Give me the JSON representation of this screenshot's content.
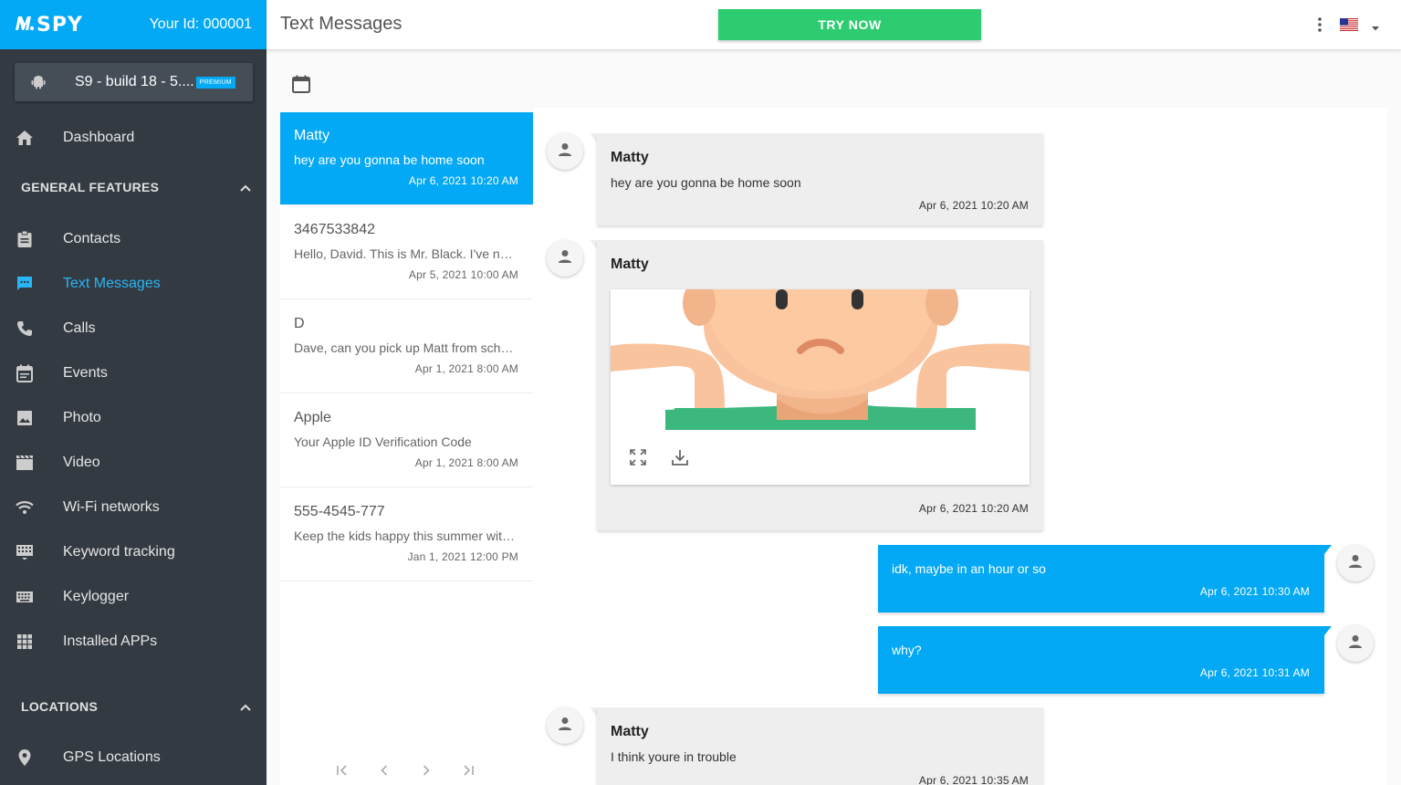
{
  "app": {
    "logo_text": "SPY",
    "user_id": "Your Id: 000001",
    "device_name": "S9 - build 18 - 5....",
    "device_badge": "PREMIUM"
  },
  "sidebar": {
    "dashboard": "Dashboard",
    "general_header": "GENERAL FEATURES",
    "items": [
      {
        "label": "Contacts",
        "icon": "clipboard-icon"
      },
      {
        "label": "Text Messages",
        "icon": "message-icon",
        "active": true
      },
      {
        "label": "Calls",
        "icon": "phone-icon"
      },
      {
        "label": "Events",
        "icon": "calendar-icon"
      },
      {
        "label": "Photo",
        "icon": "image-icon"
      },
      {
        "label": "Video",
        "icon": "movie-icon"
      },
      {
        "label": "Wi-Fi networks",
        "icon": "wifi-icon"
      },
      {
        "label": "Keyword tracking",
        "icon": "keyboard-monitor-icon"
      },
      {
        "label": "Keylogger",
        "icon": "keyboard-icon"
      },
      {
        "label": "Installed APPs",
        "icon": "apps-grid-icon"
      }
    ],
    "locations_header": "LOCATIONS",
    "gps": "GPS Locations"
  },
  "header": {
    "title": "Text Messages",
    "try_now": "TRY NOW"
  },
  "conversations": [
    {
      "name": "Matty",
      "preview": "hey are you gonna be home soon",
      "time": "Apr 6, 2021 10:20 AM",
      "active": true
    },
    {
      "name": "3467533842",
      "preview": "Hello, David. This is Mr. Black. I've noticed",
      "time": "Apr 5, 2021 10:00 AM"
    },
    {
      "name": "D",
      "preview": "Dave, can you pick up Matt from school today",
      "time": "Apr 1, 2021 8:00 AM"
    },
    {
      "name": "Apple",
      "preview": "Your Apple ID Verification Code",
      "time": "Apr 1, 2021 8:00 AM"
    },
    {
      "name": "555-4545-777",
      "preview": "Keep the kids happy this summer with our deals",
      "time": "Jan 1, 2021 12:00 PM"
    }
  ],
  "messages": [
    {
      "direction": "in",
      "sender": "Matty",
      "text": "hey are you gonna be home soon",
      "time": "Apr 6, 2021 10:20 AM"
    },
    {
      "direction": "in",
      "sender": "Matty",
      "media": "image",
      "time": "Apr 6, 2021 10:20 AM"
    },
    {
      "direction": "out",
      "text": "idk, maybe in an hour or so",
      "time": "Apr 6, 2021 10:30 AM"
    },
    {
      "direction": "out",
      "text": "why?",
      "time": "Apr 6, 2021 10:31 AM"
    },
    {
      "direction": "in",
      "sender": "Matty",
      "text": "I think youre in trouble",
      "time": "Apr 6, 2021 10:35 AM"
    }
  ],
  "colors": {
    "accent": "#03a9f4",
    "sidebar_bg": "#333a42",
    "try_now": "#2ecc71"
  }
}
